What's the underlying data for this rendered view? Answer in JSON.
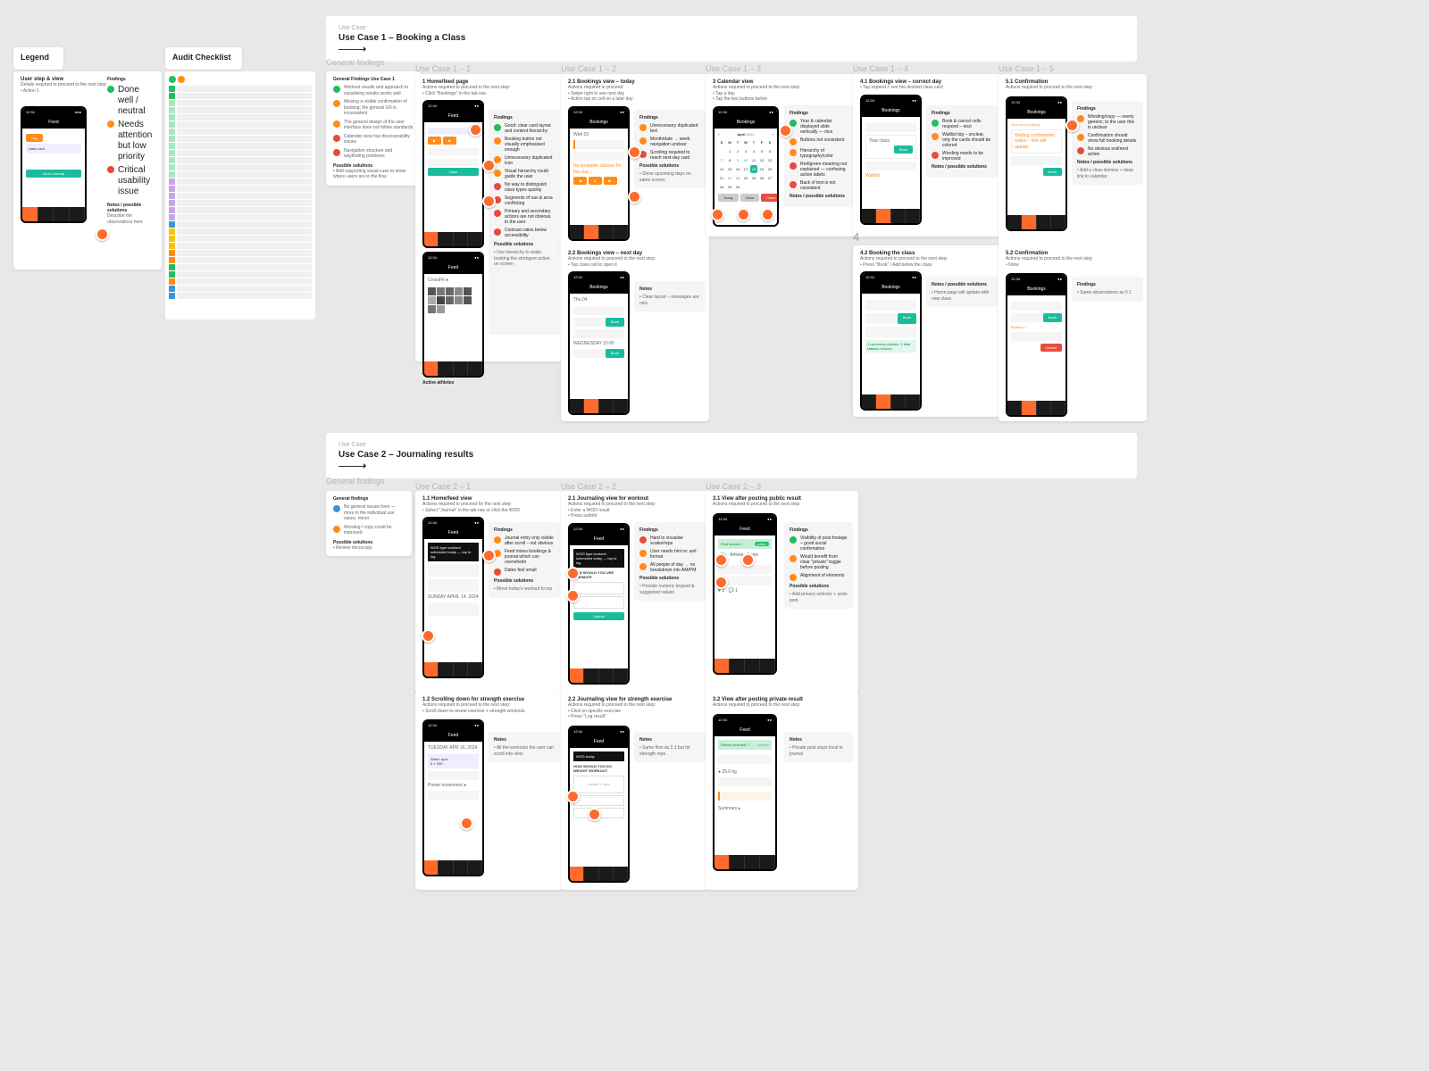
{
  "legend": {
    "title": "Legend",
    "step_title": "User step & view",
    "step_desc": "Details required to proceed to the next step:\n• Action 1",
    "findings_title": "Findings",
    "findings": [
      {
        "dot": "#20c05c",
        "text": "Done well / neutral"
      },
      {
        "dot": "#ff8c1a",
        "text": "Needs attention but low priority"
      },
      {
        "dot": "#e74c3c",
        "text": "Critical usability issue"
      }
    ],
    "notes_title": "Notes / possible solutions",
    "notes": "Describe the observations here"
  },
  "checklist": {
    "title": "Audit Checklist",
    "rows": [
      {
        "c": "#20c05c"
      },
      {
        "c": "#20c05c"
      },
      {
        "c": "#a5e6c0"
      },
      {
        "c": "#a5e6c0"
      },
      {
        "c": "#a5e6c0"
      },
      {
        "c": "#a5e6c0"
      },
      {
        "c": "#a5e6c0"
      },
      {
        "c": "#a5e6c0"
      },
      {
        "c": "#a5e6c0"
      },
      {
        "c": "#a5e6c0"
      },
      {
        "c": "#a5e6c0"
      },
      {
        "c": "#a5e6c0"
      },
      {
        "c": "#a5e6c0"
      },
      {
        "c": "#c7a5e6"
      },
      {
        "c": "#c7a5e6"
      },
      {
        "c": "#c7a5e6"
      },
      {
        "c": "#c7a5e6"
      },
      {
        "c": "#c7a5e6"
      },
      {
        "c": "#c7a5e6"
      },
      {
        "c": "#3498db"
      },
      {
        "c": "#f1c40f"
      },
      {
        "c": "#f1c40f"
      },
      {
        "c": "#f1c40f"
      },
      {
        "c": "#ff8c1a"
      },
      {
        "c": "#ff8c1a"
      },
      {
        "c": "#20c05c"
      },
      {
        "c": "#20c05c"
      },
      {
        "c": "#ff8c1a"
      },
      {
        "c": "#3498db"
      },
      {
        "c": "#3498db"
      }
    ]
  },
  "uc1": {
    "label": "Use Case",
    "title": "Use Case 1 – Booking a Class"
  },
  "uc2": {
    "label": "Use Case",
    "title": "Use Case 2 – Journaling results"
  },
  "cols": {
    "gf": "General findings",
    "c11": "Use Case 1 – 1",
    "c12": "Use Case 1 – 2",
    "c13": "Use Case 1 – 3",
    "c14": "Use Case 1 – 4",
    "c15": "Use Case 1 – 5",
    "c21": "Use Case 2 – 1",
    "c22": "Use Case 2 – 2",
    "c23": "Use Case 2 – 3"
  },
  "gf1": {
    "title": "General Findings Use Case 1",
    "items": [
      {
        "d": "#20c05c",
        "t": "Workout results and approach to visualising results works well"
      },
      {
        "d": "#ff8c1a",
        "t": "Missing a visible confirmation of booking; the general UX is inconsistent"
      },
      {
        "d": "#ff8c1a",
        "t": "The general design of the user interface does not follow standards"
      },
      {
        "d": "#e74c3c",
        "t": "Calendar view has discoverability issues"
      },
      {
        "d": "#e74c3c",
        "t": "Navigation structure and wayfinding problems"
      }
    ],
    "ps_title": "Possible solutions",
    "ps": "• Add supporting visual cues to show where users are in the flow"
  },
  "gf2": {
    "title": "General findings",
    "items": [
      {
        "d": "#3498db",
        "t": "No general issues here — more in the individual use cases, minor"
      },
      {
        "d": "#ff8c1a",
        "t": "Wording / copy could be improved"
      }
    ],
    "ps_title": "Possible solutions",
    "ps": "• Review microcopy"
  },
  "s11": {
    "title": "1 Home/feed page",
    "desc": "Actions required to proceed to the next step:\n• Click \"Bookings\" in the tab-nav",
    "f_title": "Findings"
  },
  "s12a": {
    "title": "2.1 Bookings view – today",
    "desc": "Actions required to proceed:\n• Swipe right to see next day\n• Action tap on cell on a later day",
    "f_title": "Findings",
    "ps_title": "Possible solutions"
  },
  "s12b": {
    "title": "2.2 Bookings view – next day",
    "desc": "Actions required to proceed to the next step:\n• Tap class cell to open it",
    "notes_title": "Notes",
    "notes": "• Clear layout – messages are nice"
  },
  "s13": {
    "title": "3 Calendar view",
    "desc": "Actions required to proceed to the next step:\n• Tap a day\n• Tap the two buttons below",
    "f_title": "Findings",
    "notes_title": "Notes / possible solutions"
  },
  "s14a": {
    "title": "4.1 Bookings view – correct day",
    "desc": "• Tap expand > see the desired class card",
    "f_title": "Findings",
    "notes_title": "Notes / possible solutions"
  },
  "s14b": {
    "title": "4.2 Booking the class",
    "desc": "Actions required to proceed to the next step:\n• Press \"Book\" / Add below the class",
    "label4": "4",
    "ok": "1 upcoming classes, 1 total classes booked",
    "notes_title": "Notes / possible solutions",
    "notes": "• Home page will update with new class"
  },
  "s15a": {
    "title": "5.1 Confirmation",
    "desc": "Actions required to proceed to the next step",
    "f_title": "Findings",
    "notes_title": "Notes / possible solutions"
  },
  "s15b": {
    "title": "5.2 Confirmation",
    "desc": "Actions required to proceed to the next step\n• None"
  },
  "s21a": {
    "title": "1.1 Home/feed view",
    "desc": "Actions required to proceed for the next step:\n• Select \"Journal\" in the tab-nav or click the WOD",
    "f_title": "Findings",
    "ps_title": "Possible solutions"
  },
  "s21b": {
    "title": "1.2 Scrolling down for strength exercise",
    "desc": "Actions required to proceed to the next step:\n• Scroll down to reveal exercise + strength workouts"
  },
  "s22a": {
    "title": "2.1 Journaling view for workout",
    "desc": "Actions required to proceed to the next step:\n• Enter a WOD result\n• Press submit",
    "f_title": "Findings",
    "ps_title": "Possible solutions"
  },
  "s22b": {
    "title": "2.2 Journaling view for strength exercise",
    "desc": "Actions required to proceed to the next step:\n• Click on specific exercise\n• Press \"Log result\"",
    "notes_title": "Notes"
  },
  "s23a": {
    "title": "3.1 View after posting public result",
    "desc": "Actions required to proceed to the next step:",
    "f_title": "Findings",
    "ps_title": "Possible solutions"
  },
  "s23b": {
    "title": "3.2 View after posting private result",
    "desc": "Actions required to proceed to the next step:",
    "notes_title": "Notes"
  },
  "phone": {
    "time": "12:34",
    "feed": "Feed",
    "book": "Bookings",
    "wod": "HOW WOULD YOU USE WODMATE",
    "btn_book": "Book",
    "btn_cancel": "Cancel",
    "btn_today": "Today",
    "btn_close": "Close",
    "btn_clear": "Clear",
    "go": "Go to Journal",
    "btn_log": "Log",
    "month": "April",
    "year": "2024"
  },
  "cal_days": [
    "S",
    "M",
    "T",
    "W",
    "T",
    "F",
    "S"
  ],
  "cal_nums": [
    "",
    "1",
    "2",
    "3",
    "4",
    "5",
    "6",
    "7",
    "8",
    "9",
    "10",
    "11",
    "12",
    "13",
    "14",
    "15",
    "16",
    "17",
    "18",
    "19",
    "20",
    "21",
    "22",
    "23",
    "24",
    "25",
    "26",
    "27",
    "28",
    "29",
    "30",
    ""
  ],
  "findings_generic": [
    {
      "d": "#20c05c",
      "t": "Good: clear card layout and content hierarchy"
    },
    {
      "d": "#ff8c1a",
      "t": "Booking button not visually emphasised enough"
    },
    {
      "d": "#ff8c1a",
      "t": "Unnecessary duplicated icon"
    },
    {
      "d": "#e74c3c",
      "t": "No way to distinguish class types quickly"
    },
    {
      "d": "#e74c3c",
      "t": "Text contrast below accessibility threshold"
    }
  ]
}
